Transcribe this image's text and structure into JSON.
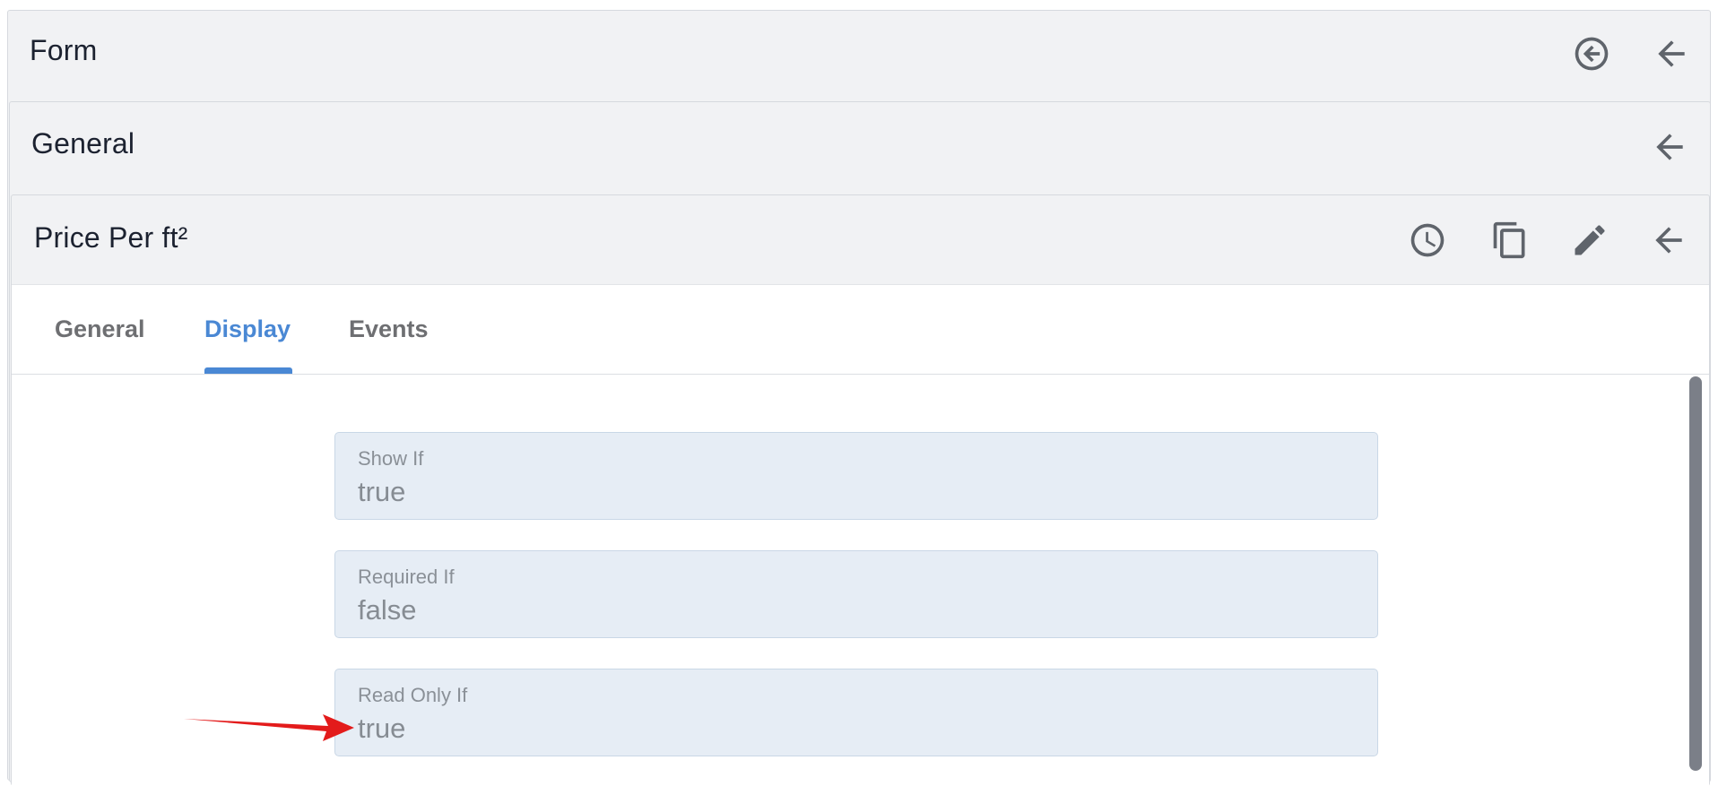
{
  "panels": {
    "form": {
      "title": "Form"
    },
    "general": {
      "title": "General"
    },
    "field": {
      "title": "Price Per ft²"
    }
  },
  "tabs": [
    {
      "label": "General",
      "active": false
    },
    {
      "label": "Display",
      "active": true
    },
    {
      "label": "Events",
      "active": false
    }
  ],
  "display_fields": [
    {
      "label": "Show If",
      "value": "true"
    },
    {
      "label": "Required If",
      "value": "false"
    },
    {
      "label": "Read Only If",
      "value": "true"
    }
  ],
  "icons": {
    "form_header": [
      "exit-circle-icon",
      "back-arrow-icon"
    ],
    "general_header": [
      "back-arrow-icon"
    ],
    "field_header": [
      "history-clock-icon",
      "copy-icon",
      "edit-pencil-icon",
      "back-arrow-icon"
    ]
  },
  "colors": {
    "accent": "#4a88d4",
    "panel_bg": "#f1f2f4",
    "field_bg": "#e6edf5",
    "annotation_arrow": "#e31b1b"
  }
}
